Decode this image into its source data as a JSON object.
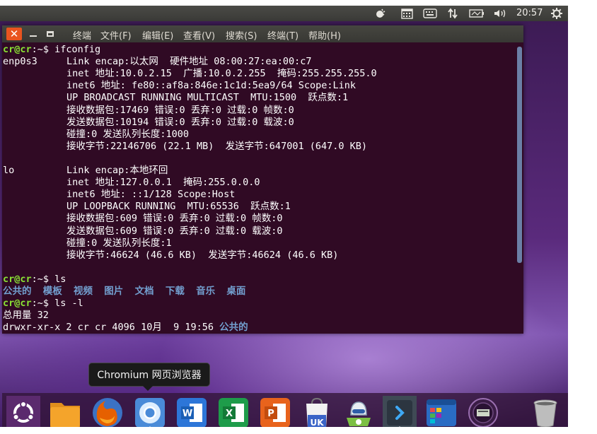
{
  "top_panel": {
    "clock": "20:57",
    "icons": [
      "weather-icon",
      "calendar-icon",
      "keyboard-icon",
      "network-updown-icon",
      "battery-icon",
      "volume-icon",
      "gear-icon"
    ]
  },
  "window": {
    "menu": [
      "终端",
      "文件(F)",
      "编辑(E)",
      "查看(V)",
      "搜索(S)",
      "终端(T)",
      "帮助(H)"
    ]
  },
  "terminal": {
    "prompt_user": "cr@cr",
    "prompt_suffix": ":~$ ",
    "lines": [
      {
        "type": "prompt",
        "cmd": "ifconfig"
      },
      {
        "type": "iface",
        "name": "enp0s3",
        "text": "Link encap:以太网  硬件地址 08:00:27:ea:00:c7"
      },
      {
        "type": "text",
        "text": "inet 地址:10.0.2.15  广播:10.0.2.255  掩码:255.255.255.0"
      },
      {
        "type": "text",
        "text": "inet6 地址: fe80::af8a:846e:1c1d:5ea9/64 Scope:Link"
      },
      {
        "type": "text",
        "text": "UP BROADCAST RUNNING MULTICAST  MTU:1500  跃点数:1"
      },
      {
        "type": "text",
        "text": "接收数据包:17469 错误:0 丢弃:0 过载:0 帧数:0"
      },
      {
        "type": "text",
        "text": "发送数据包:10194 错误:0 丢弃:0 过载:0 载波:0"
      },
      {
        "type": "text",
        "text": "碰撞:0 发送队列长度:1000"
      },
      {
        "type": "text",
        "text": "接收字节:22146706 (22.1 MB)  发送字节:647001 (647.0 KB)"
      },
      {
        "type": "blank"
      },
      {
        "type": "iface",
        "name": "lo",
        "text": "Link encap:本地环回"
      },
      {
        "type": "text",
        "text": "inet 地址:127.0.0.1  掩码:255.0.0.0"
      },
      {
        "type": "text",
        "text": "inet6 地址: ::1/128 Scope:Host"
      },
      {
        "type": "text",
        "text": "UP LOOPBACK RUNNING  MTU:65536  跃点数:1"
      },
      {
        "type": "text",
        "text": "接收数据包:609 错误:0 丢弃:0 过载:0 帧数:0"
      },
      {
        "type": "text",
        "text": "发送数据包:609 错误:0 丢弃:0 过载:0 载波:0"
      },
      {
        "type": "text",
        "text": "碰撞:0 发送队列长度:1"
      },
      {
        "type": "text",
        "text": "接收字节:46624 (46.6 KB)  发送字节:46624 (46.6 KB)"
      },
      {
        "type": "blank"
      },
      {
        "type": "prompt",
        "cmd": "ls"
      },
      {
        "type": "dirs",
        "items": [
          "公共的",
          "模板",
          "视频",
          "图片",
          "文档",
          "下载",
          "音乐",
          "桌面"
        ]
      },
      {
        "type": "prompt",
        "cmd": "ls -l"
      },
      {
        "type": "plain",
        "text": "总用量 32"
      },
      {
        "type": "lsrow",
        "text": "drwxr-xr-x 2 cr cr 4096 10月  9 19:56 ",
        "dir": "公共的"
      }
    ]
  },
  "tooltip": "Chromium 网页浏览器",
  "dock": {
    "items": [
      "ubuntu-dash-icon",
      "files-icon",
      "firefox-icon",
      "chromium-icon",
      "wps-writer-icon",
      "wps-spreadsheet-icon",
      "wps-presentation-icon",
      "language-support-icon",
      "software-updater-icon",
      "terminal-icon",
      "workspace-switcher-icon",
      "disk-icon",
      "trash-icon"
    ],
    "uk_label": "UK",
    "colors": {
      "ubuntu": "#e95420",
      "files": "#f4a42b",
      "firefox": "#e66000",
      "chromium": "#4a8bd8",
      "writer": "#2d76d8",
      "sheet": "#1e9c4a",
      "pres": "#e8631c"
    }
  }
}
